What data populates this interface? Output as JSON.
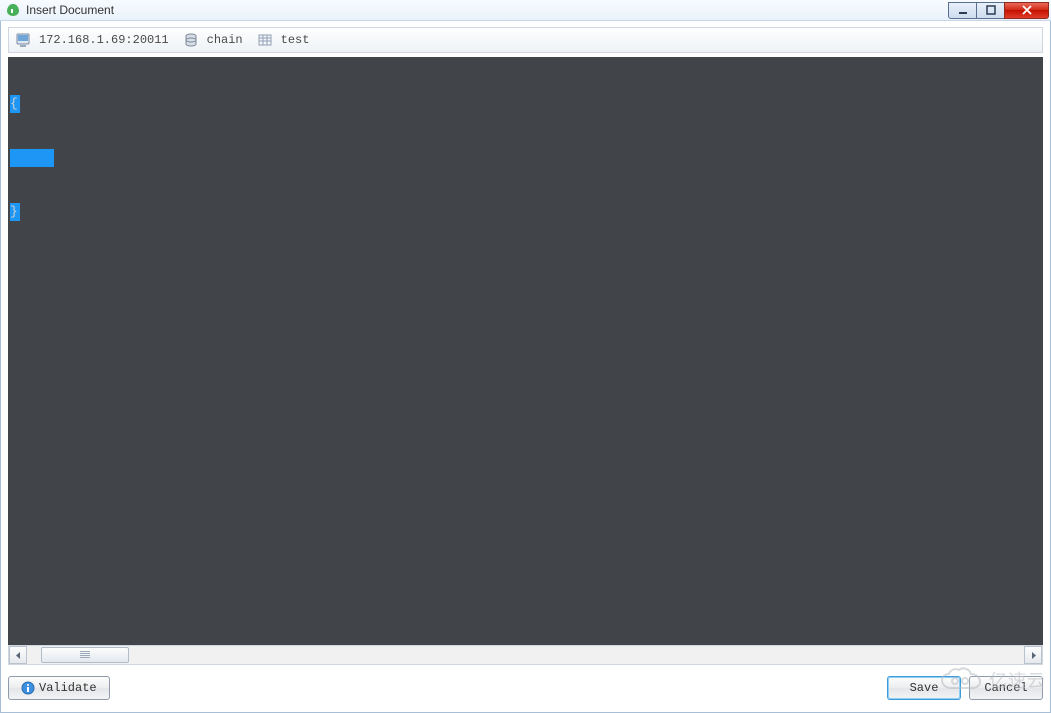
{
  "window": {
    "title": "Insert Document"
  },
  "path": {
    "server": "172.168.1.69:20011",
    "database": "chain",
    "collection": "test"
  },
  "editor": {
    "line1": "{",
    "line2": "",
    "line3": "}"
  },
  "footer": {
    "validate_label": "Validate",
    "save_label": "Save",
    "cancel_label": "Cancel"
  },
  "watermark": {
    "text": "亿速云"
  }
}
